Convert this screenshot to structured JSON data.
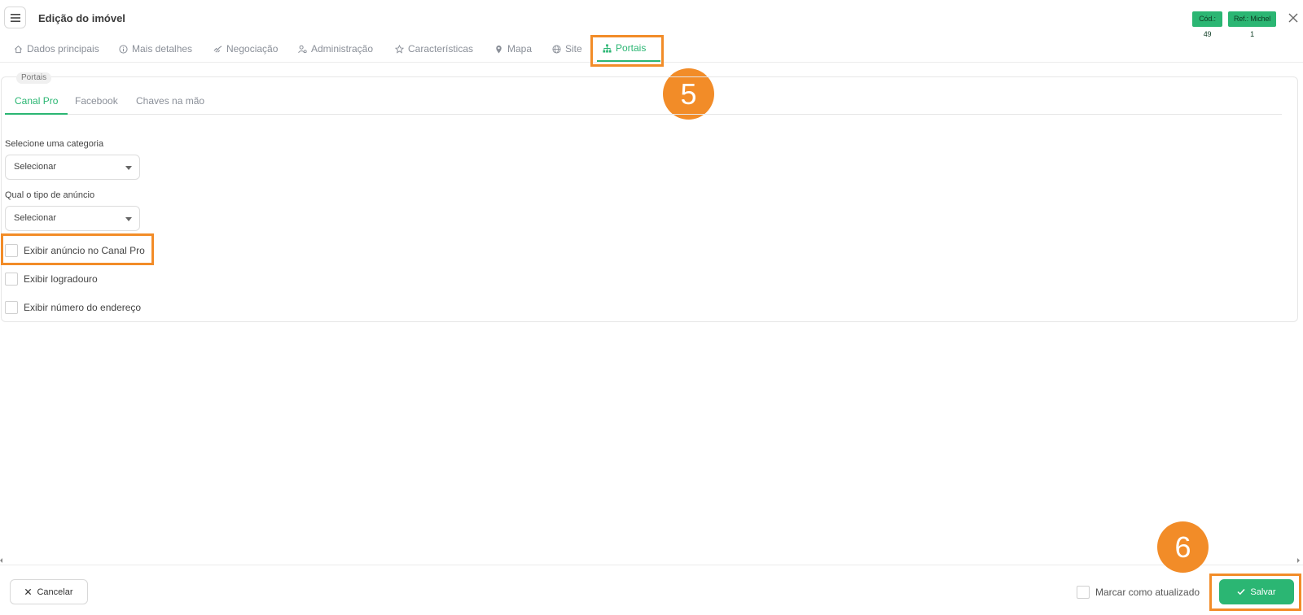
{
  "header": {
    "title": "Edição do imóvel",
    "badge_cod": "Cód.: 49",
    "badge_ref": "Ref.: Michel 1",
    "accent_color": "#2bb673",
    "highlight_color": "#f28c28"
  },
  "tabs": [
    {
      "label": "Dados principais",
      "icon": "home-icon"
    },
    {
      "label": "Mais detalhes",
      "icon": "info-icon"
    },
    {
      "label": "Negociação",
      "icon": "handshake-icon"
    },
    {
      "label": "Administração",
      "icon": "user-gear-icon"
    },
    {
      "label": "Características",
      "icon": "star-icon"
    },
    {
      "label": "Mapa",
      "icon": "map-pin-icon"
    },
    {
      "label": "Site",
      "icon": "globe-icon"
    },
    {
      "label": "Portais",
      "icon": "sitemap-icon",
      "active": true
    }
  ],
  "portais": {
    "legend": "Portais",
    "subtabs": [
      {
        "label": "Canal Pro",
        "active": true
      },
      {
        "label": "Facebook"
      },
      {
        "label": "Chaves na mão"
      }
    ],
    "categoria": {
      "label": "Selecione uma categoria",
      "value": "Selecionar"
    },
    "tipo_anuncio": {
      "label": "Qual o tipo de anúncio",
      "value": "Selecionar"
    },
    "checkboxes": [
      {
        "label": "Exibir anúncio no Canal Pro",
        "checked": false
      },
      {
        "label": "Exibir logradouro",
        "checked": false
      },
      {
        "label": "Exibir número do endereço",
        "checked": false
      }
    ]
  },
  "steps": {
    "five": "5",
    "six": "6"
  },
  "footer": {
    "cancel_label": "Cancelar",
    "marcar_label": "Marcar como atualizado",
    "save_label": "Salvar"
  }
}
